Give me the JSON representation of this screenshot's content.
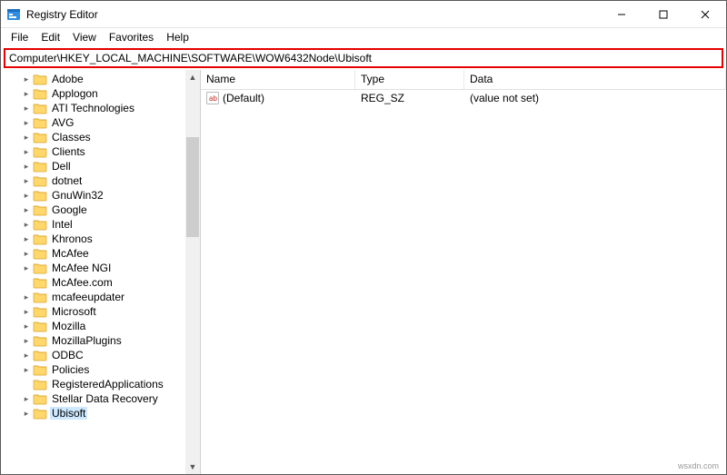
{
  "window": {
    "title": "Registry Editor"
  },
  "menu": {
    "file": "File",
    "edit": "Edit",
    "view": "View",
    "favorites": "Favorites",
    "help": "Help"
  },
  "address": {
    "value": "Computer\\HKEY_LOCAL_MACHINE\\SOFTWARE\\WOW6432Node\\Ubisoft"
  },
  "columns": {
    "name": "Name",
    "type": "Type",
    "data": "Data"
  },
  "values": [
    {
      "name": "(Default)",
      "type": "REG_SZ",
      "data": "(value not set)"
    }
  ],
  "tree": [
    {
      "label": "Adobe",
      "indent": 2,
      "expandable": true
    },
    {
      "label": "Applogon",
      "indent": 2,
      "expandable": true
    },
    {
      "label": "ATI Technologies",
      "indent": 2,
      "expandable": true
    },
    {
      "label": "AVG",
      "indent": 2,
      "expandable": true
    },
    {
      "label": "Classes",
      "indent": 2,
      "expandable": true
    },
    {
      "label": "Clients",
      "indent": 2,
      "expandable": true
    },
    {
      "label": "Dell",
      "indent": 2,
      "expandable": true
    },
    {
      "label": "dotnet",
      "indent": 2,
      "expandable": true
    },
    {
      "label": "GnuWin32",
      "indent": 2,
      "expandable": true
    },
    {
      "label": "Google",
      "indent": 2,
      "expandable": true
    },
    {
      "label": "Intel",
      "indent": 2,
      "expandable": true
    },
    {
      "label": "Khronos",
      "indent": 2,
      "expandable": true
    },
    {
      "label": "McAfee",
      "indent": 2,
      "expandable": true
    },
    {
      "label": "McAfee NGI",
      "indent": 2,
      "expandable": true
    },
    {
      "label": "McAfee.com",
      "indent": 2,
      "expandable": false
    },
    {
      "label": "mcafeeupdater",
      "indent": 2,
      "expandable": true
    },
    {
      "label": "Microsoft",
      "indent": 2,
      "expandable": true
    },
    {
      "label": "Mozilla",
      "indent": 2,
      "expandable": true
    },
    {
      "label": "MozillaPlugins",
      "indent": 2,
      "expandable": true
    },
    {
      "label": "ODBC",
      "indent": 2,
      "expandable": true
    },
    {
      "label": "Policies",
      "indent": 2,
      "expandable": true
    },
    {
      "label": "RegisteredApplications",
      "indent": 2,
      "expandable": false
    },
    {
      "label": "Stellar Data Recovery",
      "indent": 2,
      "expandable": true
    },
    {
      "label": "Ubisoft",
      "indent": 2,
      "expandable": true,
      "selected": true
    }
  ],
  "watermark": "wsxdn.com"
}
